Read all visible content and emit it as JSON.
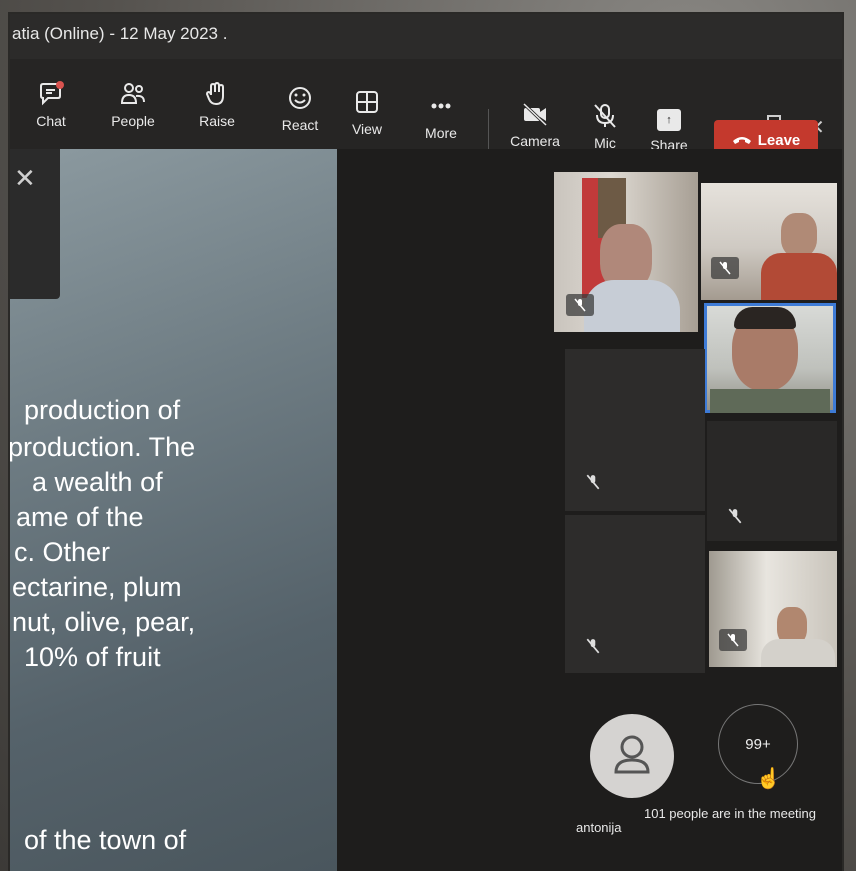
{
  "window": {
    "title": "atia (Online) - 12 May 2023 ."
  },
  "toolbar": {
    "chat": "Chat",
    "people": "People",
    "raise": "Raise",
    "react": "React",
    "view": "View",
    "more": "More",
    "camera": "Camera",
    "mic": "Mic",
    "share": "Share",
    "leave": "Leave"
  },
  "slide": {
    "lines": [
      "production of",
      "production. The",
      "a wealth of",
      "ame of the",
      "c. Other",
      "ectarine, plum",
      "nut, olive, pear,",
      "10% of fruit",
      "of the town of"
    ]
  },
  "participants": {
    "self_name": "antonija",
    "overflow_count": "99+",
    "total_text": "101 people are in the meeting"
  },
  "colors": {
    "leave": "#c4392d",
    "active_speaker": "#3e7bd6"
  }
}
